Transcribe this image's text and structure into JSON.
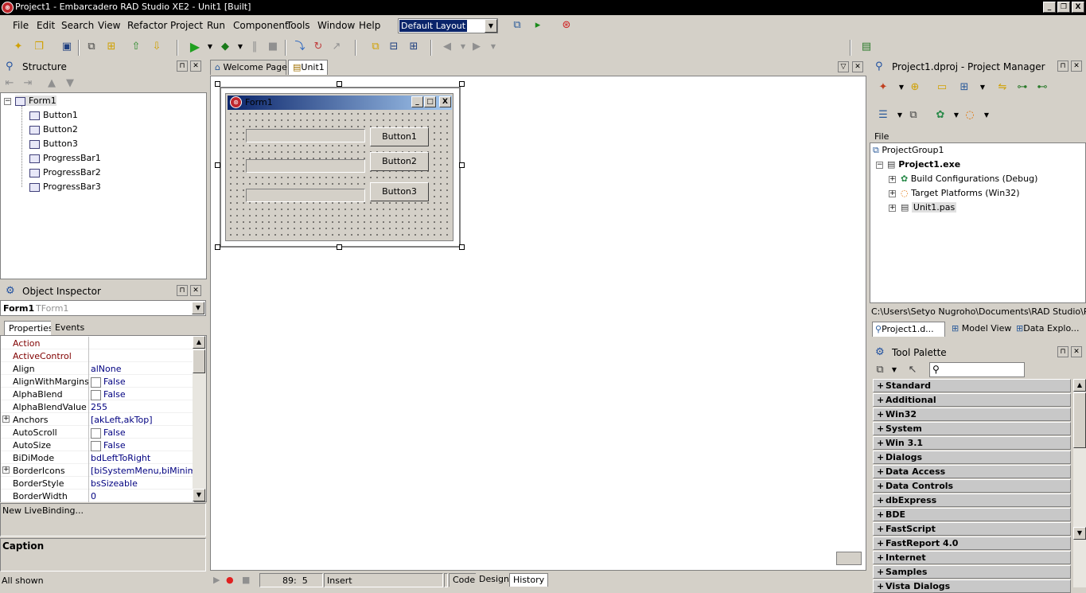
{
  "window": {
    "title": "Project1 - Embarcadero RAD Studio XE2 - Unit1 [Built]",
    "controls": [
      "_",
      "❐",
      "X"
    ]
  },
  "menu": [
    "File",
    "Edit",
    "Search",
    "View",
    "Refactor",
    "Project",
    "Run",
    "Component",
    "Tools",
    "Window",
    "Help"
  ],
  "layout_select": "Default Layout",
  "structure": {
    "title": "Structure",
    "root": "Form1",
    "children": [
      "Button1",
      "Button2",
      "Button3",
      "ProgressBar1",
      "ProgressBar2",
      "ProgressBar3"
    ]
  },
  "object_inspector": {
    "title": "Object Inspector",
    "object": "Form1",
    "object_type": "TForm1",
    "tabs": [
      "Properties",
      "Events"
    ],
    "props": [
      {
        "name": "Action",
        "value": "",
        "red": true
      },
      {
        "name": "ActiveControl",
        "value": "",
        "red": true
      },
      {
        "name": "Align",
        "value": "alNone"
      },
      {
        "name": "AlignWithMargins",
        "value": "False",
        "cb": true
      },
      {
        "name": "AlphaBlend",
        "value": "False",
        "cb": true
      },
      {
        "name": "AlphaBlendValue",
        "value": "255"
      },
      {
        "name": "Anchors",
        "value": "[akLeft,akTop]",
        "exp": true
      },
      {
        "name": "AutoScroll",
        "value": "False",
        "cb": true
      },
      {
        "name": "AutoSize",
        "value": "False",
        "cb": true
      },
      {
        "name": "BiDiMode",
        "value": "bdLeftToRight"
      },
      {
        "name": "BorderIcons",
        "value": "[biSystemMenu,biMinimize,",
        "exp": true
      },
      {
        "name": "BorderStyle",
        "value": "bsSizeable"
      },
      {
        "name": "BorderWidth",
        "value": "0"
      }
    ],
    "livebinding": "New LiveBinding...",
    "caption_label": "Caption",
    "status": "All shown"
  },
  "editor": {
    "tabs": [
      "Welcome Page",
      "Unit1"
    ],
    "form_caption": "Form1",
    "buttons": [
      "Button1",
      "Button2",
      "Button3"
    ],
    "cursor_pos": "89:  5",
    "mode": "Insert",
    "bottom_tabs": [
      "Code",
      "Design",
      "History"
    ]
  },
  "project_manager": {
    "title": "Project1.dproj - Project Manager",
    "column": "File",
    "group": "ProjectGroup1",
    "project": "Project1.exe",
    "items": [
      "Build Configurations (Debug)",
      "Target Platforms (Win32)",
      "Unit1.pas"
    ],
    "path": "C:\\Users\\Setyo Nugroho\\Documents\\RAD Studio\\Projects",
    "tabs": [
      "Project1.d...",
      "Model View",
      "Data Explo..."
    ]
  },
  "tool_palette": {
    "title": "Tool Palette",
    "search_placeholder": "",
    "categories": [
      "Standard",
      "Additional",
      "Win32",
      "System",
      "Win 3.1",
      "Dialogs",
      "Data Access",
      "Data Controls",
      "dbExpress",
      "BDE",
      "FastScript",
      "FastReport 4.0",
      "Internet",
      "Samples",
      "Vista Dialogs"
    ]
  }
}
